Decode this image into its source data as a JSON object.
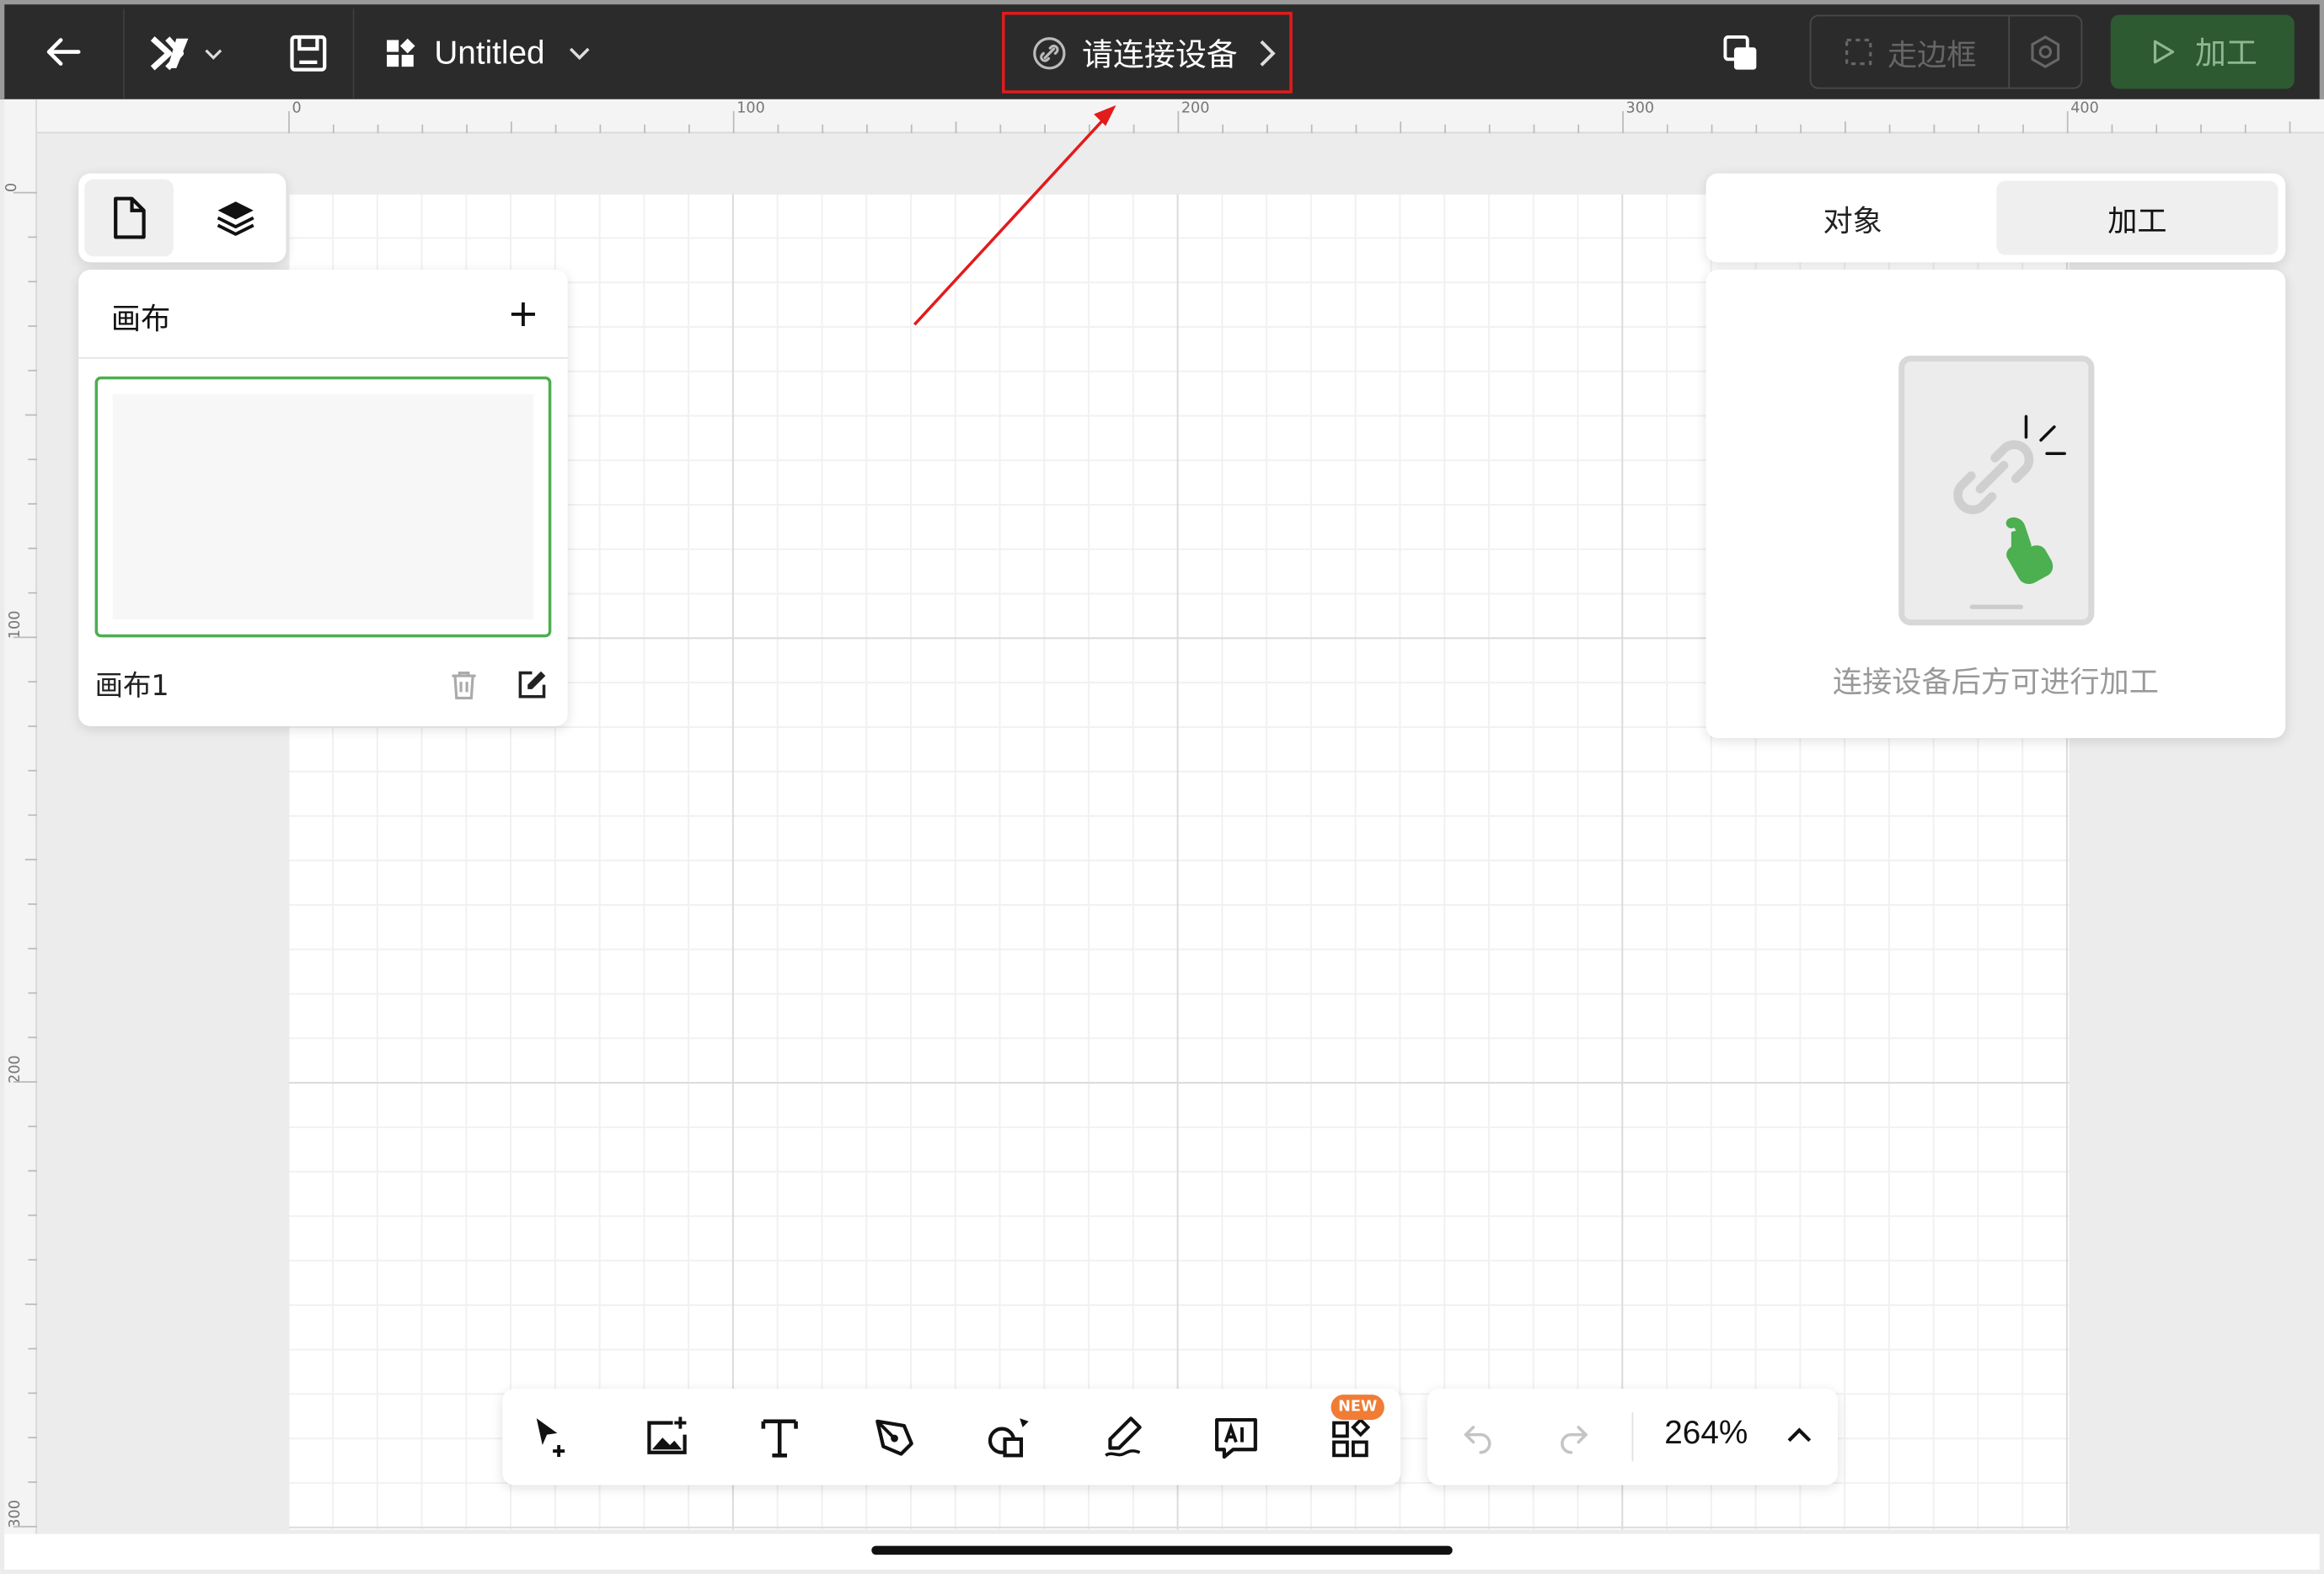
{
  "topbar": {
    "doc_title": "Untitled",
    "connect_label": "请连接设备",
    "frame_label": "走边框",
    "process_label": "加工"
  },
  "ruler": {
    "top_ticks": [
      "0",
      "100",
      "200",
      "300",
      "400"
    ],
    "left_ticks": [
      "0",
      "100",
      "200",
      "300"
    ]
  },
  "canvas_panel": {
    "title": "画布",
    "canvas_name": "画布1"
  },
  "right_panel": {
    "tabs": [
      "对象",
      "加工"
    ],
    "active_tab": "加工",
    "empty_message": "连接设备后方可进行加工"
  },
  "bottom_toolbar": {
    "new_badge": "NEW",
    "zoom": "264%"
  },
  "icons": [
    "back-arrow-icon",
    "logo-icon",
    "chevron-down-icon",
    "save-icon",
    "template-icon",
    "link-icon",
    "chevron-right-icon",
    "copy-icon",
    "frame-icon",
    "settings-icon",
    "play-icon",
    "file-icon",
    "layers-icon",
    "plus-icon",
    "trash-icon",
    "edit-icon",
    "select-add-icon",
    "image-add-icon",
    "text-icon",
    "pen-icon",
    "shapes-icon",
    "draw-icon",
    "ai-icon",
    "apps-icon",
    "undo-icon",
    "redo-icon",
    "chevron-up-icon"
  ],
  "colors": {
    "topbar_bg": "#2b2b2b",
    "accent_green": "#4caf50",
    "process_button_bg": "#2e5a32",
    "highlight_red": "#e21b1b",
    "new_badge": "#f07c35"
  }
}
